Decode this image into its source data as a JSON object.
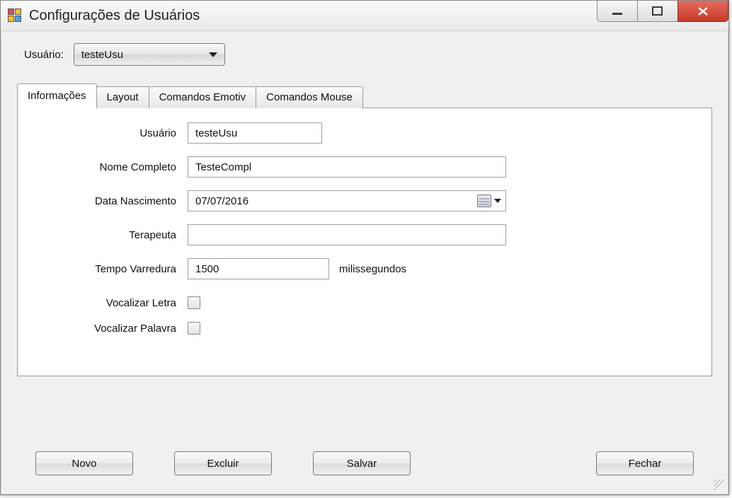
{
  "window": {
    "title": "Configurações de Usuários"
  },
  "top": {
    "user_label": "Usuário:",
    "user_value": "testeUsu"
  },
  "tabs": {
    "info": "Informações",
    "layout": "Layout",
    "emotiv": "Comandos Emotiv",
    "mouse": "Comandos Mouse"
  },
  "form": {
    "usuario_label": "Usuário",
    "usuario_value": "testeUsu",
    "nome_label": "Nome Completo",
    "nome_value": "TesteCompl",
    "data_label": "Data Nascimento",
    "data_value": "07/07/2016",
    "terapeuta_label": "Terapeuta",
    "terapeuta_value": "",
    "tempo_label": "Tempo Varredura",
    "tempo_value": "1500",
    "tempo_unit": "milissegundos",
    "voc_letra_label": "Vocalizar Letra",
    "voc_palavra_label": "Vocalizar Palavra"
  },
  "buttons": {
    "novo": "Novo",
    "excluir": "Excluir",
    "salvar": "Salvar",
    "fechar": "Fechar"
  }
}
